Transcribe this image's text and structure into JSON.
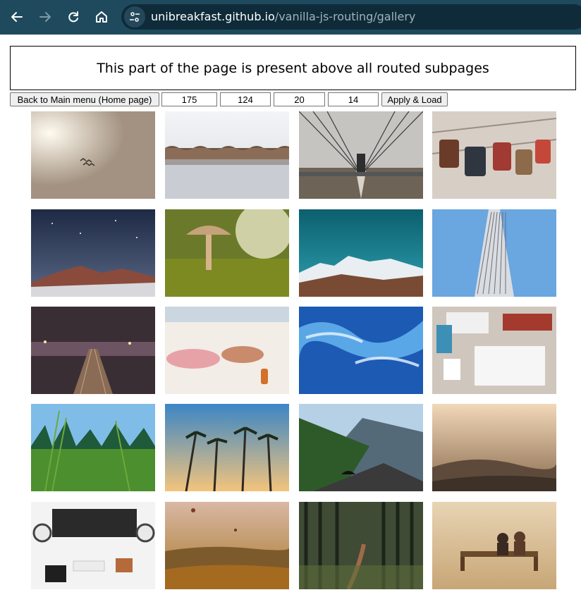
{
  "browser": {
    "url_host": "unibreakfast.github.io",
    "url_path": "/vanilla-js-routing/gallery",
    "icons": [
      "back-arrow-icon",
      "forward-arrow-icon",
      "reload-icon",
      "home-icon",
      "site-settings-icon"
    ]
  },
  "header": {
    "text": "This part of the page is present above all routed subpages"
  },
  "controls": {
    "back_button": "Back to Main menu (Home page)",
    "width": "175",
    "height": "124",
    "count": "20",
    "gap": "14",
    "apply_button": "Apply & Load"
  },
  "gallery": {
    "images": [
      {
        "name": "birds-in-hazy-sky"
      },
      {
        "name": "breakwater-sea"
      },
      {
        "name": "bridge-cables"
      },
      {
        "name": "love-locks"
      },
      {
        "name": "night-sky-mountains"
      },
      {
        "name": "mushroom-closeup"
      },
      {
        "name": "snowy-mountains"
      },
      {
        "name": "skyscraper-up-view"
      },
      {
        "name": "rail-yard-night"
      },
      {
        "name": "beach-sunbathers"
      },
      {
        "name": "ocean-waves"
      },
      {
        "name": "desk-flatlay"
      },
      {
        "name": "grass-field-trees"
      },
      {
        "name": "palm-trees"
      },
      {
        "name": "mountain-road-tunnel"
      },
      {
        "name": "foggy-hills"
      },
      {
        "name": "desk-workspace"
      },
      {
        "name": "hot-air-balloons"
      },
      {
        "name": "forest-path"
      },
      {
        "name": "couple-on-bench"
      }
    ]
  }
}
